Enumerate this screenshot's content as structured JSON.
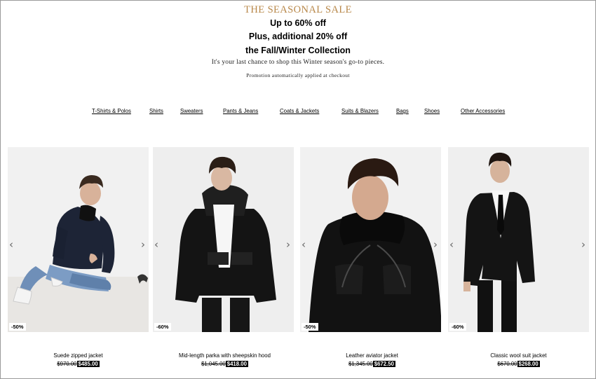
{
  "promo": {
    "eyebrow": "THE SEASONAL SALE",
    "headline1": "Up to 60% off",
    "headline2": "Plus, additional 20% off",
    "headline3": "the Fall/Winter Collection",
    "subtitle": "It's your last chance to shop this Winter season's go-to pieces.",
    "note": "Promotion automatically applied at checkout",
    "accent_color": "#b8884a"
  },
  "categories": [
    {
      "label": "T-Shirts & Polos"
    },
    {
      "label": "Shirts"
    },
    {
      "label": "Sweaters"
    },
    {
      "label": "Pants & Jeans"
    },
    {
      "label": "Coats & Jackets"
    },
    {
      "label": "Suits & Blazers"
    },
    {
      "label": "Bags"
    },
    {
      "label": "Shoes"
    },
    {
      "label": "Other Accessories"
    }
  ],
  "products": [
    {
      "name": "Suede zipped jacket",
      "old_price": "$970.00",
      "new_price": "$485.00",
      "discount": "-50%",
      "image": "model-suede-jacket-photo"
    },
    {
      "name": "Mid-length parka with sheepskin hood",
      "old_price": "$1,045.00",
      "new_price": "$418.00",
      "discount": "-60%",
      "image": "model-parka-photo"
    },
    {
      "name": "Leather aviator jacket",
      "old_price": "$1,345.00",
      "new_price": "$672.50",
      "discount": "-50%",
      "image": "model-leather-jacket-photo"
    },
    {
      "name": "Classic wool suit jacket",
      "old_price": "$670.00",
      "new_price": "$268.00",
      "discount": "-60%",
      "image": "model-suit-photo"
    }
  ],
  "icons": {
    "prev": "chevron-left-icon",
    "next": "chevron-right-icon"
  }
}
